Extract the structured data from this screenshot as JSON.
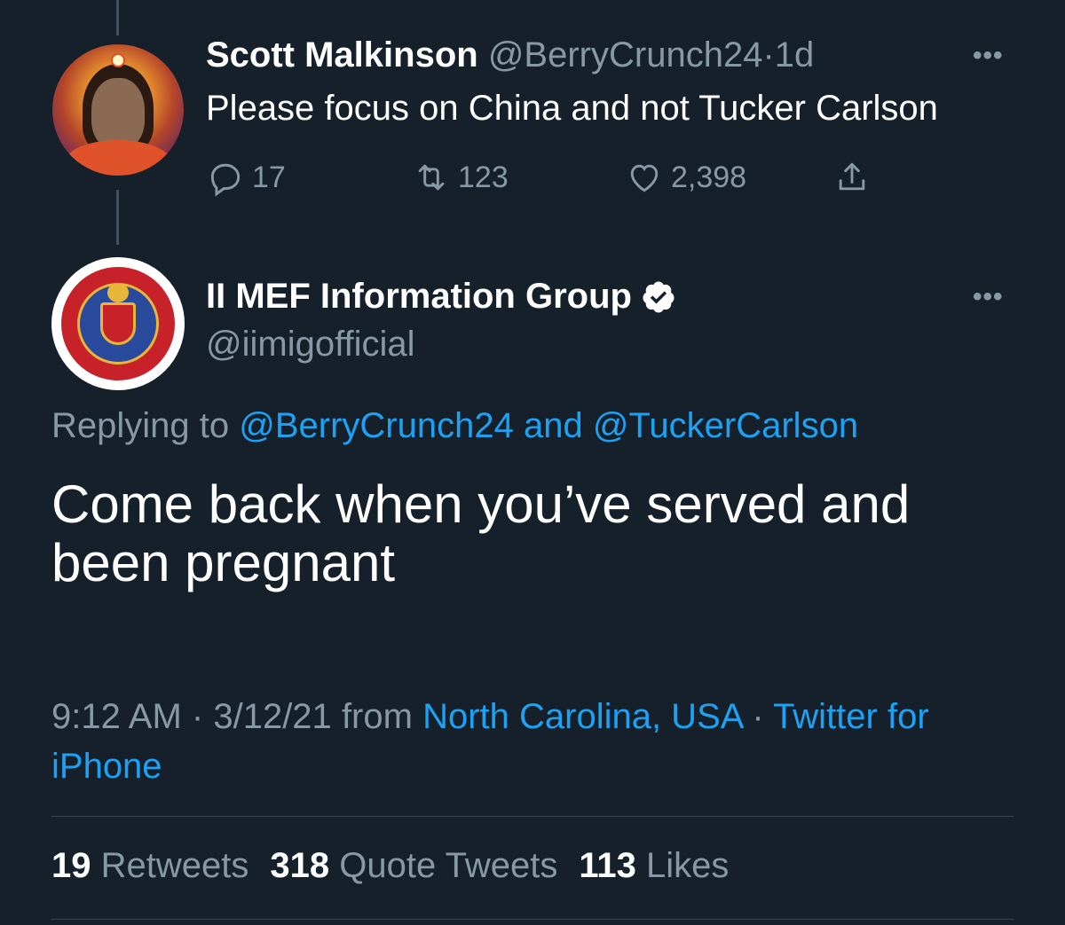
{
  "tweet1": {
    "name": "Scott Malkinson",
    "handle": "@BerryCrunch24",
    "separator": "·",
    "time": "1d",
    "more": "•••",
    "text": "Please focus on China and not Tucker Carlson",
    "replies": "17",
    "retweets": "123",
    "likes": "2,398"
  },
  "tweet2": {
    "name": "II MEF Information Group",
    "handle": "@iimigofficial",
    "more": "•••",
    "replying_prefix": "Replying to",
    "replying_user1": "@BerryCrunch24",
    "replying_and": "and",
    "replying_user2": "@TuckerCarlson",
    "text": "Come back when you’ve served and been pregnant",
    "time": "9:12 AM",
    "dot": "·",
    "date": "3/12/21",
    "from": "from",
    "location": "North Carolina, USA",
    "client": "Twitter for iPhone"
  },
  "stats": {
    "retweets_count": "19",
    "retweets_label": "Retweets",
    "quotes_count": "318",
    "quotes_label": "Quote Tweets",
    "likes_count": "113",
    "likes_label": "Likes"
  },
  "colors": {
    "background": "#15202b",
    "secondary_text": "#8899a6",
    "link": "#1da1f2",
    "divider": "#38444d"
  }
}
